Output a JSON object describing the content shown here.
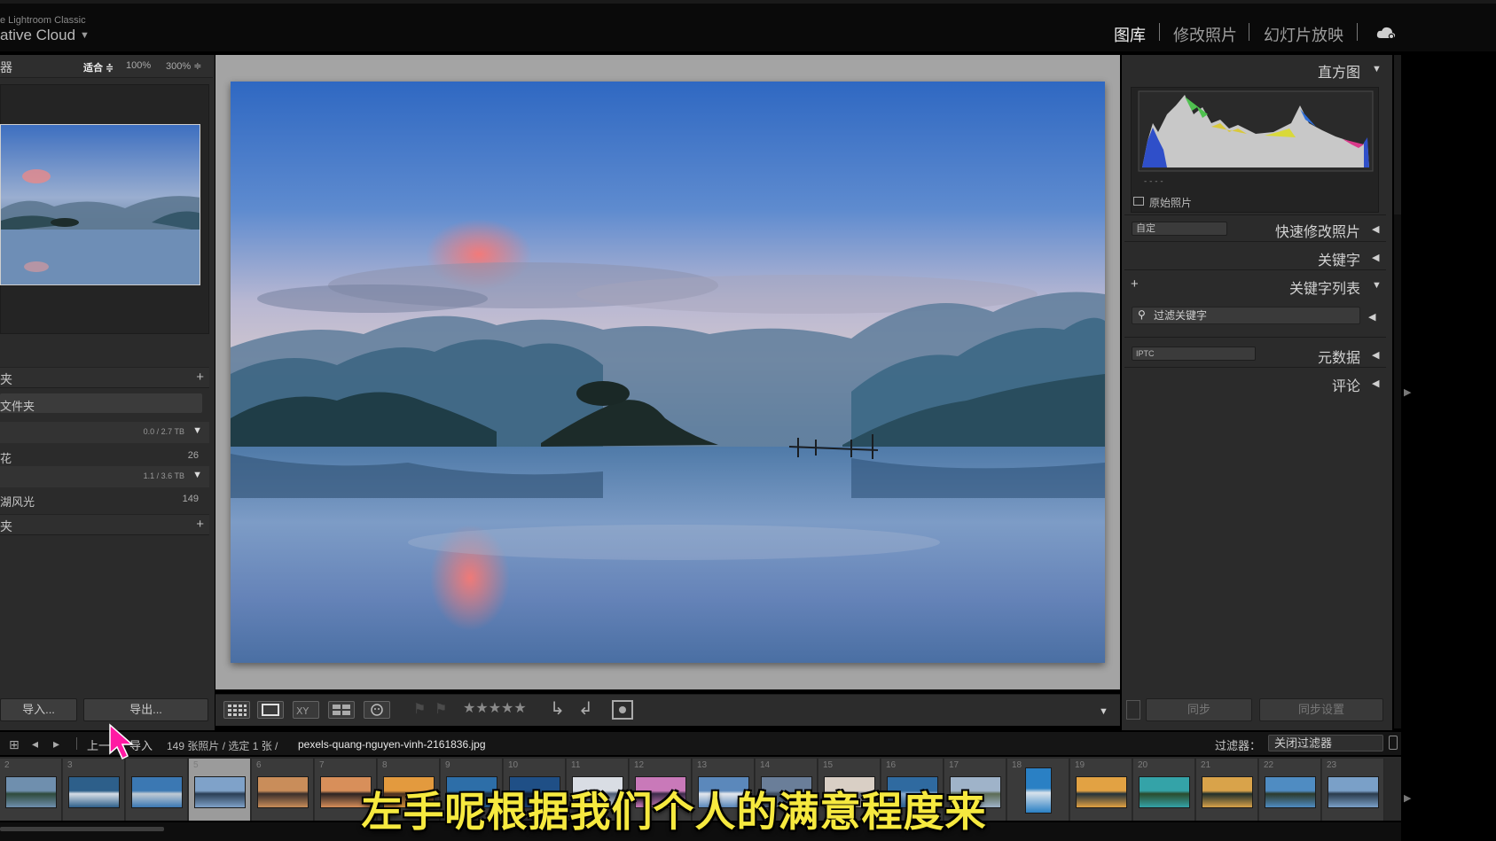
{
  "app": {
    "brand_small": "e Lightroom Classic",
    "brand_big": "ative Cloud"
  },
  "modules": [
    "图库",
    "修改照片",
    "幻灯片放映"
  ],
  "navigator": {
    "label": "器",
    "zoom_fit": "适合 ≑",
    "zoom_100": "100%",
    "zoom_300": "300%  ≑"
  },
  "left_panel": {
    "folders_header": "夹",
    "folder_root": "文件夹",
    "volume1_capacity": "0.0 / 2.7 TB",
    "folder_flowers": "花",
    "folder_flowers_count": "26",
    "volume2_capacity": "1.1 / 3.6 TB",
    "folder_lake": "湖风光",
    "folder_lake_count": "149",
    "collections_header": "夹",
    "import_button": "导入...",
    "export_button": "导出..."
  },
  "toolbar": {
    "stars": "★★★★★"
  },
  "right_panel": {
    "histogram": "直方图",
    "original_photo": "原始照片",
    "quick_develop": "快速修改照片",
    "quick_develop_preset": "自定",
    "keywording": "关键字",
    "keyword_list": "关键字列表",
    "keyword_filter_placeholder": "过滤关键字",
    "metadata": "元数据",
    "metadata_preset": "IPTC",
    "comments": "评论",
    "sync_button": "同步",
    "sync_settings_button": "同步设置"
  },
  "infobar": {
    "prev_label": "上一",
    "import_label": "导入",
    "summary": "149 张照片 / 选定 1 张 / ",
    "filename": "pexels-quang-nguyen-vinh-2161836.jpg",
    "filter_label": "过滤器：",
    "filter_value": "关闭过滤器"
  },
  "filmstrip": {
    "cells": [
      {
        "num": "2"
      },
      {
        "num": "3"
      },
      {
        "num": ""
      },
      {
        "num": "5"
      },
      {
        "num": "6"
      },
      {
        "num": "7"
      },
      {
        "num": "8"
      },
      {
        "num": "9"
      },
      {
        "num": "10"
      },
      {
        "num": "11"
      },
      {
        "num": "12"
      },
      {
        "num": "13"
      },
      {
        "num": "14"
      },
      {
        "num": "15"
      },
      {
        "num": "16"
      },
      {
        "num": "17"
      },
      {
        "num": "18"
      },
      {
        "num": "19"
      },
      {
        "num": "20"
      },
      {
        "num": "21"
      },
      {
        "num": "22"
      },
      {
        "num": "23"
      }
    ]
  },
  "subtitle": "左手呢根据我们个人的满意程度来",
  "colors": {
    "accent_subtitle": "#f6e93f",
    "panel_bg": "#2b2b2b",
    "canvas_bg": "#a4a4a4"
  }
}
